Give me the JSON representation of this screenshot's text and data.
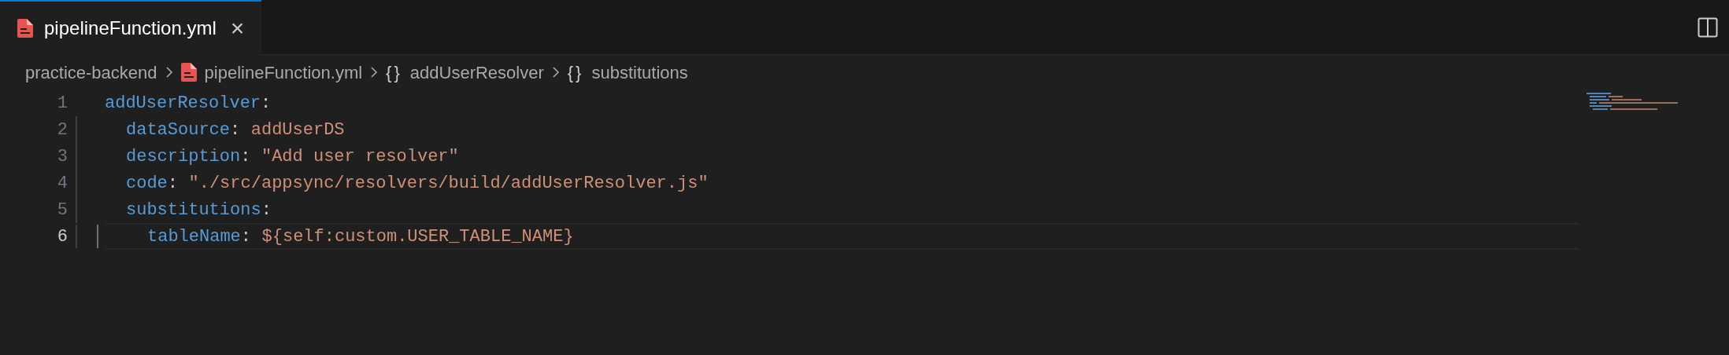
{
  "tabs": [
    {
      "label": "pipelineFunction.yml",
      "selected": true,
      "close": "×"
    }
  ],
  "breadcrumbs": [
    {
      "kind": "folder",
      "label": "practice-backend"
    },
    {
      "kind": "file",
      "label": "pipelineFunction.yml"
    },
    {
      "kind": "symbol",
      "icon": "{}",
      "label": "addUserResolver"
    },
    {
      "kind": "symbol",
      "icon": "{}",
      "label": "substitutions"
    }
  ],
  "code": [
    {
      "number": "1",
      "key": "addUserResolver",
      "colon": ":",
      "current": false,
      "children": [
        {
          "number": "2",
          "key": "dataSource",
          "colon": ":",
          "value": "addUserDS",
          "current": false
        },
        {
          "number": "3",
          "key": "description",
          "colon": ":",
          "value": "\"Add user resolver\"",
          "current": false
        },
        {
          "number": "4",
          "key": "code",
          "colon": ":",
          "value": "\"./src/appsync/resolvers/build/addUserResolver.js\"",
          "current": false
        },
        {
          "number": "5",
          "key": "substitutions",
          "colon": ":",
          "current": false,
          "children": [
            {
              "number": "6",
              "key": "tableName",
              "colon": ":",
              "value": "${self:custom.USER_TABLE_NAME}",
              "current": true
            }
          ]
        }
      ]
    }
  ]
}
